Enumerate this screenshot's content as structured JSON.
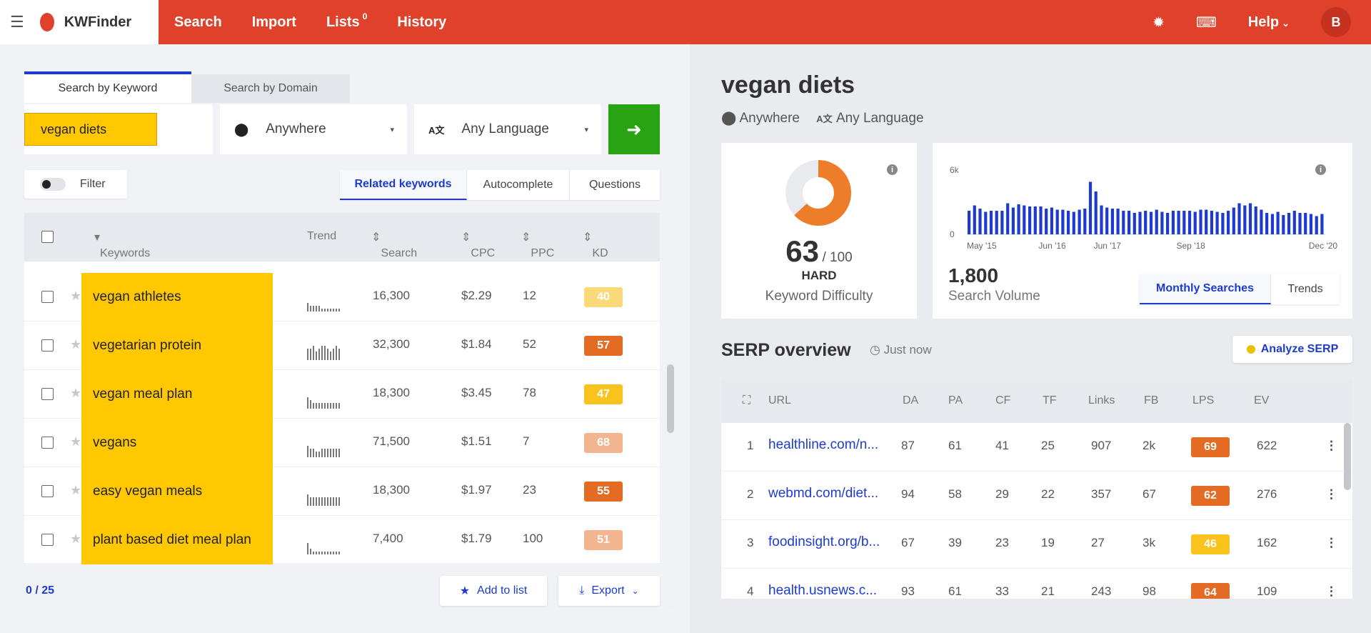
{
  "nav": {
    "brand": "KWFinder",
    "items": [
      "Search",
      "Import",
      "Lists",
      "History"
    ],
    "lists_count": "0",
    "help_label": "Help",
    "avatar_initial": "B"
  },
  "search": {
    "tabs": [
      "Search by Keyword",
      "Search by Domain"
    ],
    "keyword": "vegan diets",
    "location": "Anywhere",
    "language": "Any Language",
    "filter_label": "Filter",
    "result_tabs": [
      "Related keywords",
      "Autocomplete",
      "Questions"
    ]
  },
  "table": {
    "headers": [
      "Keywords",
      "Trend",
      "Search",
      "CPC",
      "PPC",
      "KD"
    ],
    "rows": [
      {
        "keyword": "vegan athletes",
        "search": "16,300",
        "cpc": "$2.29",
        "ppc": "12",
        "kd": "40",
        "kd_color": "#fbd979",
        "trend": [
          3,
          2,
          2,
          2,
          2,
          1,
          1,
          1,
          1,
          1,
          1,
          1
        ]
      },
      {
        "keyword": "vegetarian protein",
        "search": "32,300",
        "cpc": "$1.84",
        "ppc": "52",
        "kd": "57",
        "kd_color": "#e46b24",
        "trend": [
          4,
          4,
          5,
          3,
          4,
          5,
          5,
          4,
          3,
          4,
          5,
          4
        ]
      },
      {
        "keyword": "vegan meal plan",
        "search": "18,300",
        "cpc": "$3.45",
        "ppc": "78",
        "kd": "47",
        "kd_color": "#f9c21d",
        "trend": [
          4,
          3,
          2,
          2,
          2,
          2,
          2,
          2,
          2,
          2,
          2,
          2
        ]
      },
      {
        "keyword": "vegans",
        "search": "71,500",
        "cpc": "$1.51",
        "ppc": "7",
        "kd": "68",
        "kd_color": "#f3b58f",
        "trend": [
          4,
          3,
          3,
          2,
          2,
          3,
          3,
          3,
          3,
          3,
          3,
          3
        ]
      },
      {
        "keyword": "easy vegan meals",
        "search": "18,300",
        "cpc": "$1.97",
        "ppc": "23",
        "kd": "55",
        "kd_color": "#e46b24",
        "trend": [
          4,
          3,
          3,
          3,
          3,
          3,
          3,
          3,
          3,
          3,
          3,
          3
        ]
      },
      {
        "keyword": "plant based diet meal plan",
        "search": "7,400",
        "cpc": "$1.79",
        "ppc": "100",
        "kd": "51",
        "kd_color": "#f3b58f",
        "trend": [
          4,
          2,
          1,
          1,
          1,
          1,
          1,
          1,
          1,
          1,
          1,
          1
        ]
      }
    ],
    "selected_count": "0 / 25",
    "add_to_list": "Add to list",
    "export": "Export"
  },
  "detail": {
    "title": "vegan diets",
    "location": "Anywhere",
    "language": "Any Language",
    "kd_value": "63",
    "kd_max": "/ 100",
    "kd_label": "HARD",
    "kd_caption": "Keyword Difficulty",
    "search_volume": "1,800",
    "search_volume_caption": "Search Volume",
    "chart_tabs": [
      "Monthly Searches",
      "Trends"
    ]
  },
  "chart_data": {
    "type": "bar",
    "y_tick_labels": [
      "6k",
      "0"
    ],
    "ylim": [
      0,
      6000
    ],
    "x_tick_labels": [
      "May '15",
      "Jun '16",
      "Jun '17",
      "Sep '18",
      "Dec '20"
    ],
    "values": [
      2200,
      2700,
      2400,
      2100,
      2200,
      2200,
      2200,
      2900,
      2500,
      2800,
      2700,
      2600,
      2600,
      2600,
      2400,
      2500,
      2300,
      2300,
      2200,
      2100,
      2300,
      2400,
      4900,
      4000,
      2700,
      2500,
      2400,
      2400,
      2200,
      2200,
      2000,
      2100,
      2200,
      2100,
      2300,
      2100,
      2000,
      2200,
      2200,
      2200,
      2200,
      2100,
      2300,
      2300,
      2200,
      2100,
      2000,
      2200,
      2500,
      2900,
      2700,
      2900,
      2600,
      2300,
      2000,
      1900,
      2100,
      1800,
      2000,
      2200,
      2000,
      2000,
      1900,
      1700,
      1900
    ]
  },
  "serp": {
    "title": "SERP overview",
    "timestamp": "Just now",
    "analyze_label": "Analyze SERP",
    "headers": [
      "URL",
      "DA",
      "PA",
      "CF",
      "TF",
      "Links",
      "FB",
      "LPS",
      "EV"
    ],
    "rows": [
      {
        "rank": "1",
        "url": "healthline.com/n...",
        "da": "87",
        "pa": "61",
        "cf": "41",
        "tf": "25",
        "links": "907",
        "fb": "2k",
        "lps": "69",
        "lps_color": "#e46b24",
        "ev": "622"
      },
      {
        "rank": "2",
        "url": "webmd.com/diet...",
        "da": "94",
        "pa": "58",
        "cf": "29",
        "tf": "22",
        "links": "357",
        "fb": "67",
        "lps": "62",
        "lps_color": "#e46b24",
        "ev": "276"
      },
      {
        "rank": "3",
        "url": "foodinsight.org/b...",
        "da": "67",
        "pa": "39",
        "cf": "23",
        "tf": "19",
        "links": "27",
        "fb": "3k",
        "lps": "46",
        "lps_color": "#f9c21d",
        "ev": "162"
      },
      {
        "rank": "4",
        "url": "health.usnews.c...",
        "da": "93",
        "pa": "61",
        "cf": "33",
        "tf": "21",
        "links": "243",
        "fb": "98",
        "lps": "64",
        "lps_color": "#e46b24",
        "ev": "109"
      }
    ]
  }
}
